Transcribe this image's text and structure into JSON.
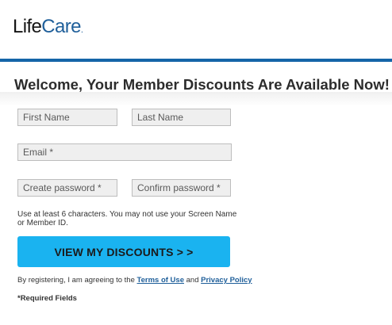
{
  "brand": {
    "logo_life": "Life",
    "logo_care": "Care",
    "logo_dot": ".",
    "accent_color": "#1565a8",
    "button_color": "#1ab3f0"
  },
  "page": {
    "title": "Welcome, Your Member Discounts Are Available Now!"
  },
  "form": {
    "first_name_placeholder": "First Name",
    "last_name_placeholder": "Last Name",
    "email_placeholder": "Email *",
    "create_password_placeholder": "Create password *",
    "confirm_password_placeholder": "Confirm password *",
    "password_hint": "Use at least 6 characters. You may not use your Screen Name or Member ID.",
    "submit_label": "VIEW MY DISCOUNTS > >"
  },
  "legal": {
    "prefix": "By registering, I am agreeing to the ",
    "terms_label": "Terms of Use",
    "and_label": " and ",
    "privacy_label": "Privacy Policy",
    "required_note": "*Required Fields"
  }
}
